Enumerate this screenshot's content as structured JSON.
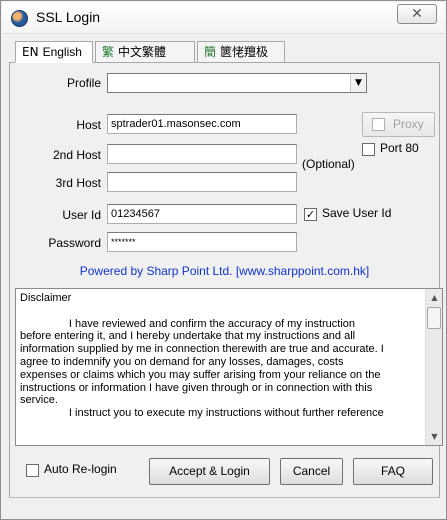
{
  "window": {
    "title": "SSL Login",
    "close_glyph": "✕"
  },
  "tabs": [
    {
      "prefix": "EN",
      "label": "English",
      "active": true
    },
    {
      "prefix": "繁",
      "label": "中文繁體",
      "active": false
    },
    {
      "prefix": "簡",
      "label": "篋恅羶极",
      "active": false
    }
  ],
  "form": {
    "profile_label": "Profile",
    "profile_value": "",
    "host_label": "Host",
    "host_value": "sptrader01.masonsec.com",
    "host2_label": "2nd Host",
    "host2_value": "",
    "host3_label": "3rd Host",
    "host3_value": "",
    "optional_label": "(Optional)",
    "proxy_label": "Proxy",
    "port80_label": "Port 80",
    "userid_label": "User Id",
    "userid_value": "01234567",
    "save_userid_label": "Save User Id",
    "password_label": "Password",
    "password_value": "*******"
  },
  "powered_by": "Powered by Sharp Point Ltd. [www.sharppoint.com.hk]",
  "disclaimer": {
    "text": "Disclaimer\n\n                I have reviewed and confirm the accuracy of my instruction\nbefore entering it, and I hereby undertake that my instructions and all\ninformation supplied by me in connection therewith are true and accurate. I\nagree to indemnify you on demand for any losses, damages, costs\nexpenses or claims which you may suffer arising from your reliance on the\ninstructions or information I have given through or in connection with this\nservice.\n                I instruct you to execute my instructions without further reference"
  },
  "footer": {
    "auto_relogin_label": "Auto Re-login",
    "accept_login_label": "Accept & Login",
    "cancel_label": "Cancel",
    "faq_label": "FAQ"
  },
  "icons": {
    "app": "ssl-globe-icon",
    "dropdown": "chevron-down-icon",
    "check": "check-icon"
  }
}
